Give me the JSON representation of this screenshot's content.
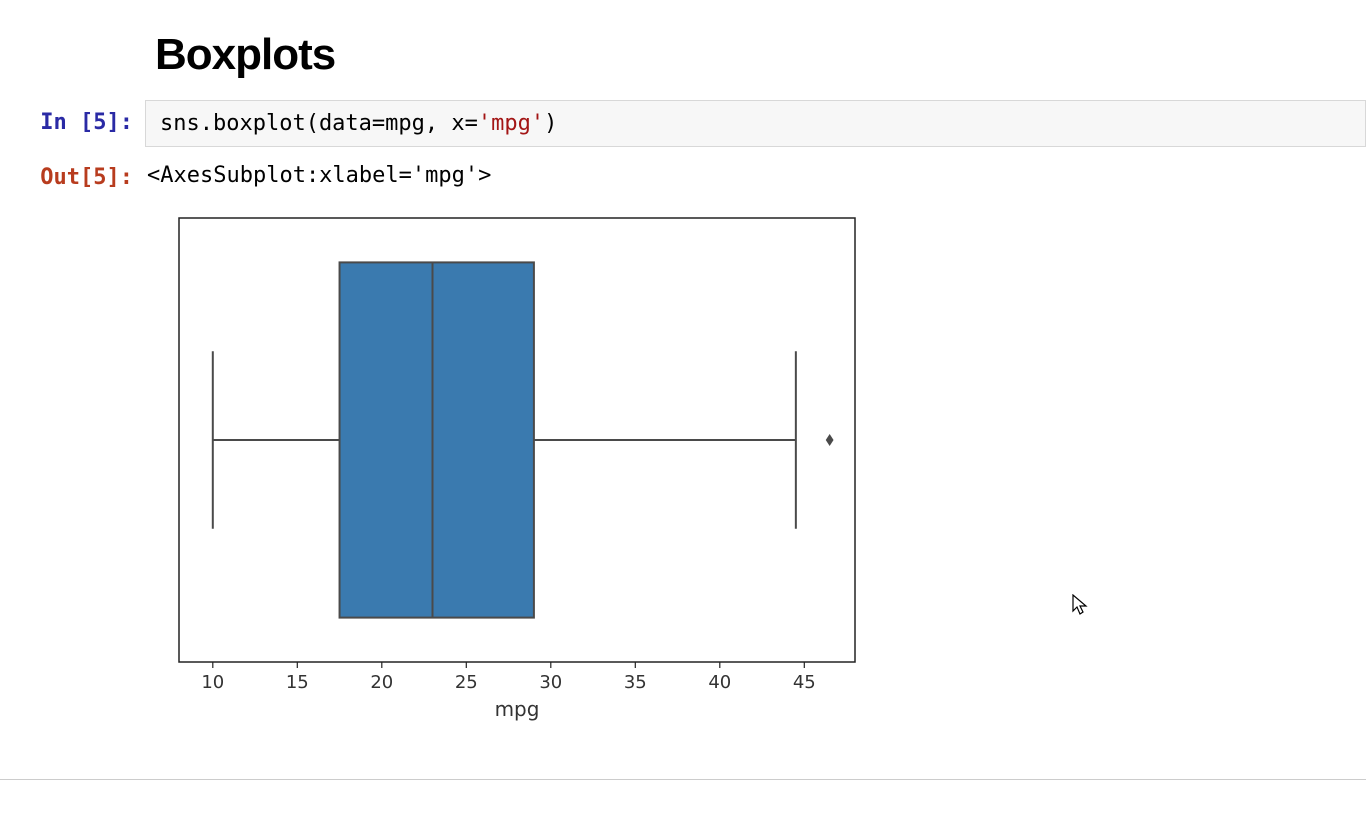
{
  "heading": "Boxplots",
  "in_prompt": "In [5]:",
  "out_prompt": "Out[5]:",
  "code_plain": "sns.boxplot(data=mpg, x='mpg')",
  "output_text": "<AxesSubplot:xlabel='mpg'>",
  "chart_data": {
    "type": "boxplot",
    "xlabel": "mpg",
    "xticks": [
      10,
      15,
      20,
      25,
      30,
      35,
      40,
      45
    ],
    "xlim": [
      8,
      48
    ],
    "q1": 17.5,
    "median": 23,
    "q3": 29,
    "whisker_low": 10,
    "whisker_high": 44.5,
    "outliers": [
      46.5
    ],
    "box_color": "#3a7aaf",
    "line_color": "#4a4a4a"
  }
}
